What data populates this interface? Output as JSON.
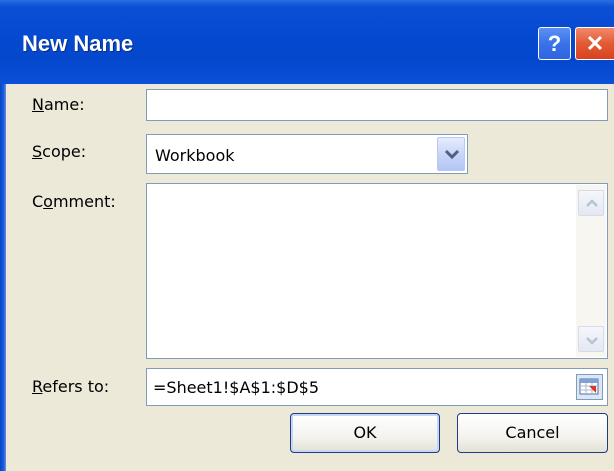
{
  "dialog": {
    "title": "New Name",
    "help_label": "?",
    "close_label": "✕"
  },
  "fields": {
    "name": {
      "label_key": "N",
      "label_rest": "ame:",
      "value": ""
    },
    "scope": {
      "label_key": "S",
      "label_rest": "cope:",
      "value": "Workbook"
    },
    "comment": {
      "label_pre": "C",
      "label_key": "o",
      "label_rest": "mment:",
      "value": ""
    },
    "refers_to": {
      "label_key": "R",
      "label_rest": "efers to:",
      "value": "=Sheet1!$A$1:$D$5"
    }
  },
  "buttons": {
    "ok": "OK",
    "cancel": "Cancel"
  },
  "icons": {
    "dropdown": "chevron-down-icon",
    "scroll_up": "scroll-up-icon",
    "scroll_down": "scroll-down-icon",
    "collapse": "collapse-dialog-icon"
  },
  "colors": {
    "titlebar": "#0549d0",
    "body": "#ece9d8",
    "field_border": "#7f9db9",
    "close_button": "#e35a36"
  }
}
